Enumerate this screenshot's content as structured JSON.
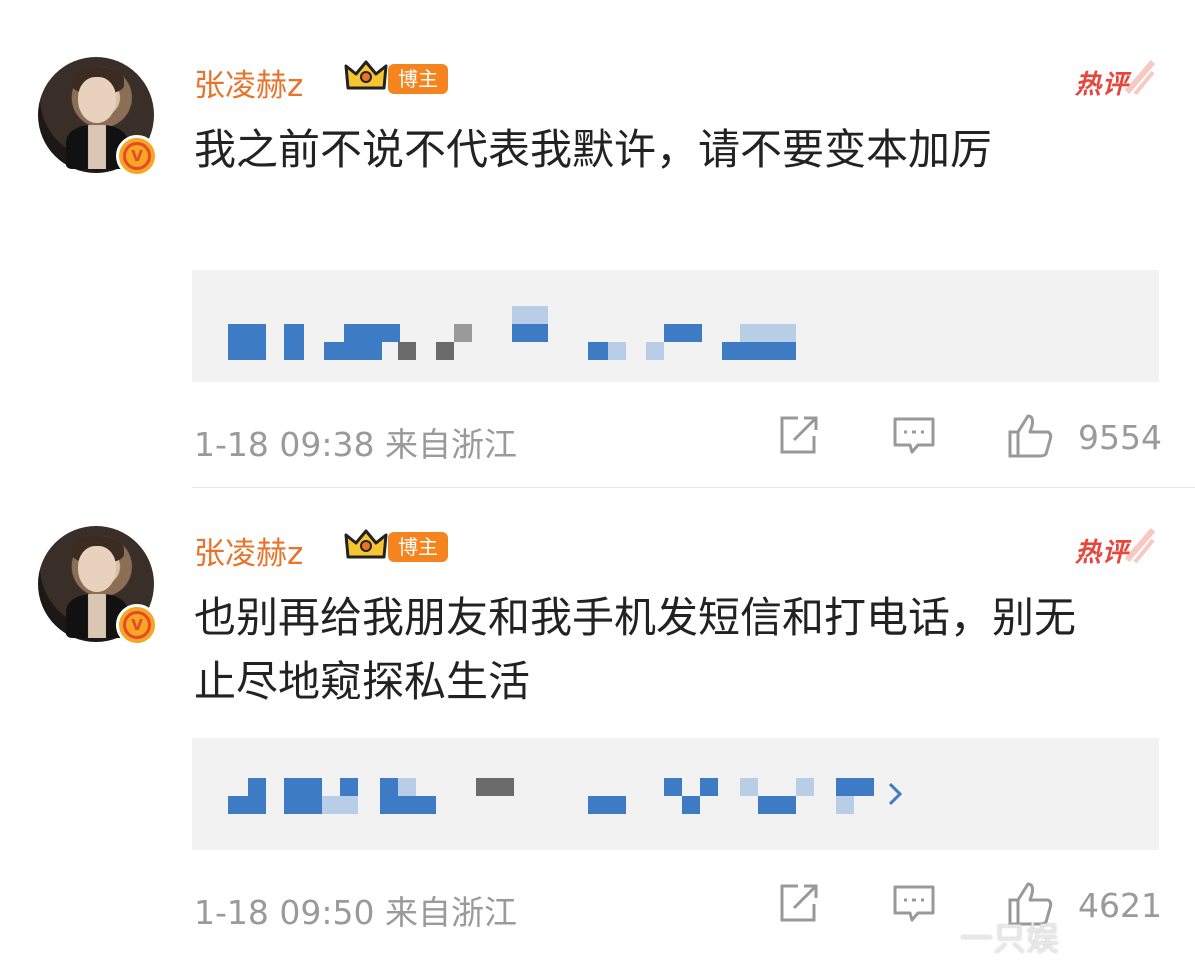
{
  "comments": [
    {
      "username": "张凌赫z",
      "badge": "博主",
      "hot_label": "热评",
      "text": "我之前不说不代表我默许，请不要变本加厉",
      "time": "1-18 09:38",
      "location": "来自浙江",
      "likes": "9554"
    },
    {
      "username": "张凌赫z",
      "badge": "博主",
      "hot_label": "热评",
      "text": "也别再给我朋友和我手机发短信和打电话，别无止尽地窥探私生活",
      "time": "1-18 09:50",
      "location": "来自浙江",
      "likes": "4621"
    }
  ],
  "watermark": "一只娱",
  "colors": {
    "username": "#e8742b",
    "hot": "#e8453c",
    "badge_bg": "#f5841f",
    "meta": "#9a9a9a",
    "pixel_blue": "#3d7bc4",
    "pixel_light": "#b8cde6",
    "pixel_gray": "#6b6b6b"
  }
}
